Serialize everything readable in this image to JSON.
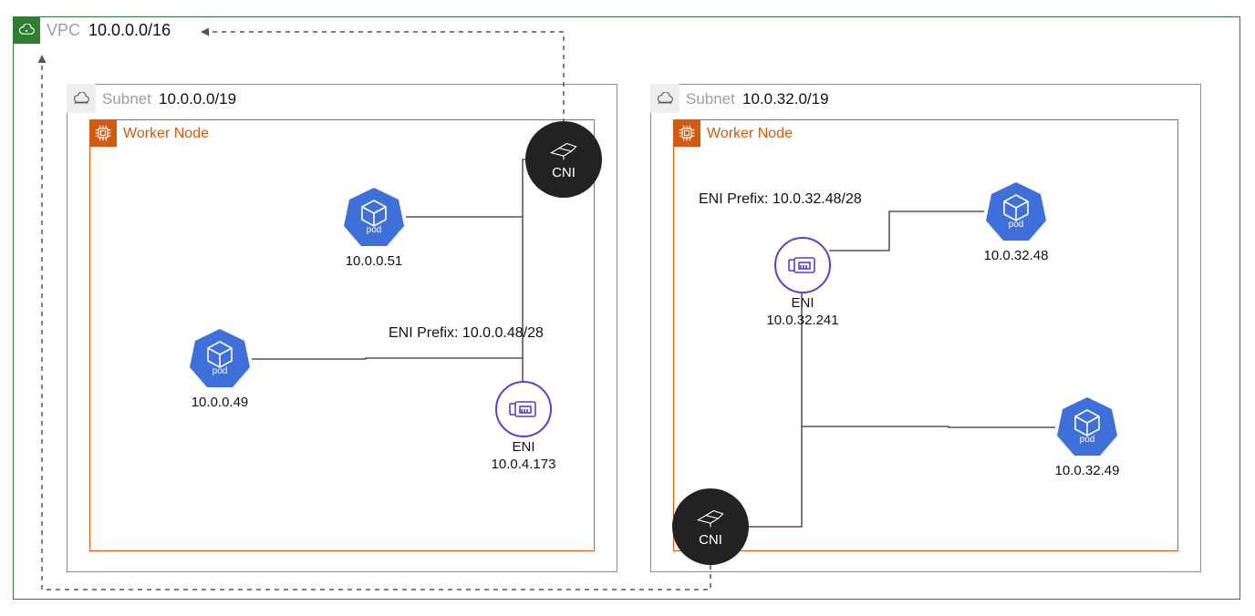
{
  "vpc": {
    "label": "VPC",
    "cidr": "10.0.0.0/16"
  },
  "subnets": [
    {
      "label": "Subnet",
      "cidr": "10.0.0.0/19",
      "worker_label": "Worker Node",
      "cni_label": "CNI",
      "eni": {
        "name": "ENI",
        "ip": "10.0.4.173",
        "prefix_label": "ENI Prefix:",
        "prefix": "10.0.0.48/28"
      },
      "pods": [
        {
          "ip": "10.0.0.51",
          "label": "pod"
        },
        {
          "ip": "10.0.0.49",
          "label": "pod"
        }
      ]
    },
    {
      "label": "Subnet",
      "cidr": "10.0.32.0/19",
      "worker_label": "Worker Node",
      "cni_label": "CNI",
      "eni": {
        "name": "ENI",
        "ip": "10.0.32.241",
        "prefix_label": "ENI Prefix:",
        "prefix": "10.0.32.48/28"
      },
      "pods": [
        {
          "ip": "10.0.32.48",
          "label": "pod"
        },
        {
          "ip": "10.0.32.49",
          "label": "pod"
        }
      ]
    }
  ]
}
